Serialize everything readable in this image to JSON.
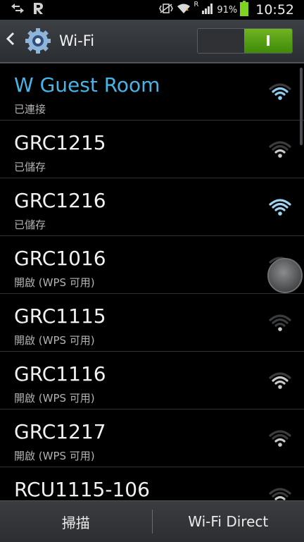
{
  "status_bar": {
    "battery_percent": "91%",
    "time": "10:52",
    "icons": [
      "sync-arrows-icon",
      "r-app-icon",
      "vibrate-icon",
      "wifi-icon",
      "roaming-r-icon",
      "signal-icon",
      "battery-icon"
    ],
    "roaming_label": "R"
  },
  "header": {
    "title": "Wi-Fi",
    "toggle_label": "I",
    "toggle_state": "on"
  },
  "networks": [
    {
      "ssid": "W Guest Room",
      "status": "已連接",
      "connected": true,
      "signal": 3
    },
    {
      "ssid": "GRC1215",
      "status": "已儲存",
      "connected": false,
      "signal": 2
    },
    {
      "ssid": "GRC1216",
      "status": "已儲存",
      "connected": false,
      "signal": 4
    },
    {
      "ssid": "GRC1016",
      "status": "開啟 (WPS 可用)",
      "connected": false,
      "signal": 2
    },
    {
      "ssid": "GRC1115",
      "status": "開啟 (WPS 可用)",
      "connected": false,
      "signal": 1
    },
    {
      "ssid": "GRC1116",
      "status": "開啟 (WPS 可用)",
      "connected": false,
      "signal": 3
    },
    {
      "ssid": "GRC1217",
      "status": "開啟 (WPS 可用)",
      "connected": false,
      "signal": 2
    },
    {
      "ssid": "RCU1115-106",
      "status": "",
      "connected": false,
      "signal": 2
    }
  ],
  "bottom_bar": {
    "scan_label": "掃描",
    "wifi_direct_label": "Wi-Fi Direct"
  },
  "colors": {
    "connected": "#4ab3e6",
    "toggle_on": "#5aa31a",
    "background": "#000000"
  }
}
